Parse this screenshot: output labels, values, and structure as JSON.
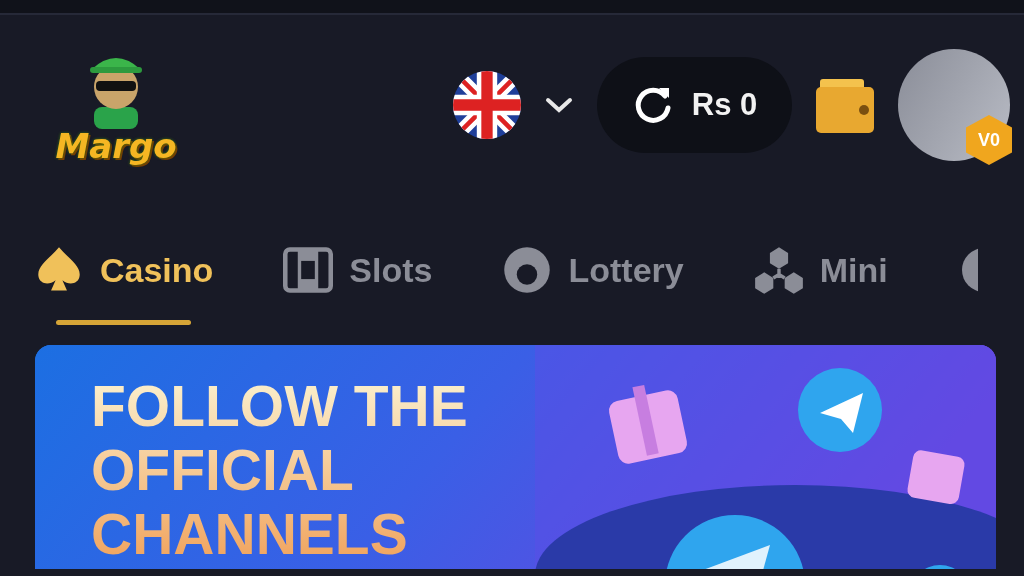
{
  "header": {
    "logo_text": "Margo",
    "balance": "Rs 0",
    "avatar": {
      "level_badge": "V0"
    }
  },
  "tabs": [
    {
      "label": "Casino",
      "kind": "spade",
      "selected": true
    },
    {
      "label": "Slots",
      "kind": "reels",
      "selected": false
    },
    {
      "label": "Lottery",
      "kind": "ball",
      "selected": false
    },
    {
      "label": "Mini",
      "kind": "cubes",
      "selected": false
    }
  ],
  "banner": {
    "title": "FOLLOW THE OFFICIAL CHANNELS"
  }
}
